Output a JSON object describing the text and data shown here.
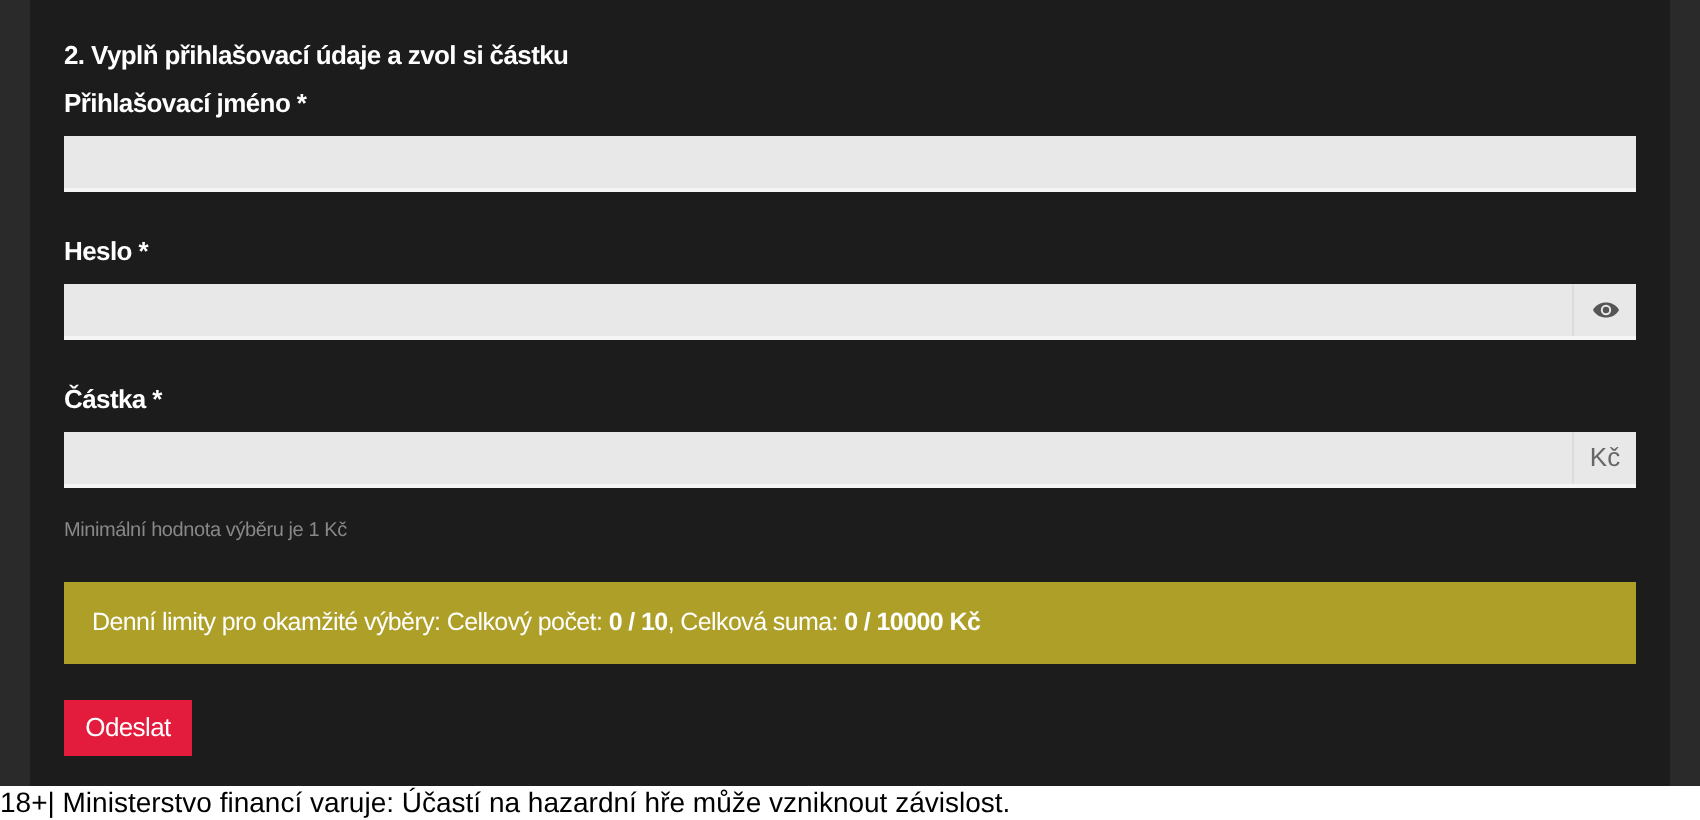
{
  "section_title": "2. Vyplň přihlašovací údaje a zvol si částku",
  "fields": [
    {
      "label": "Přihlašovací jméno *",
      "kind": "plain"
    },
    {
      "label": "Heslo *",
      "kind": "password"
    },
    {
      "label": "Částka *",
      "kind": "amount",
      "addon": "Kč"
    }
  ],
  "hint": "Minimální hodnota výběru je 1 Kč",
  "limits_banner": [
    {
      "text": "Denní limity pro okamžité výběry: Celkový počet: ",
      "bold": false
    },
    {
      "text": "0 / 10",
      "bold": true
    },
    {
      "text": ", Celková suma: ",
      "bold": false
    },
    {
      "text": "0 / 10000 Kč",
      "bold": true
    }
  ],
  "submit_button": "Odeslat",
  "footer": "18+| Ministerstvo financí varuje: Účastí na hazardní hře může vzniknout závislost."
}
